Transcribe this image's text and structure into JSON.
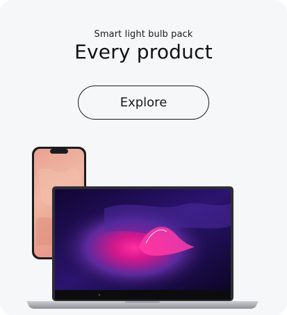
{
  "promo": {
    "eyebrow": "Smart light bulb pack",
    "headline": "Every product",
    "cta_label": "Explore"
  },
  "colors": {
    "background": "#f6f7f9",
    "text": "#111111",
    "laptop_screen_accent": "#e8148a",
    "laptop_screen_base": "#1b0c4a",
    "phone_screen": "#e7a28f"
  },
  "illustration": {
    "devices": [
      "smartphone",
      "laptop"
    ]
  }
}
